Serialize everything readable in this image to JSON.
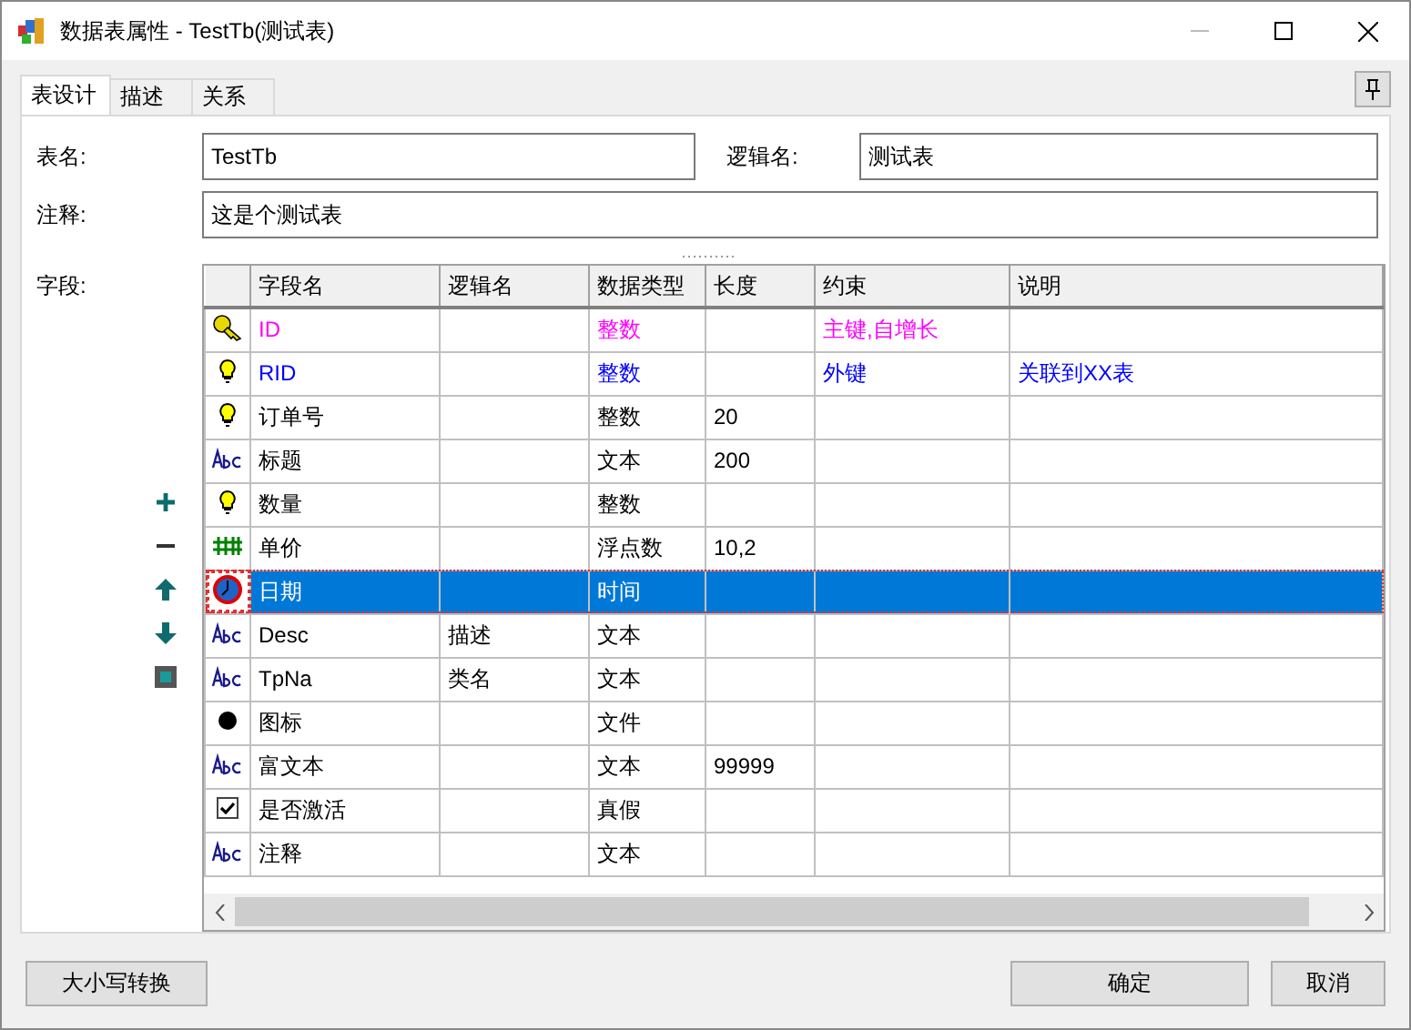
{
  "window": {
    "title": "数据表属性 - TestTb(测试表)"
  },
  "tabs": [
    {
      "label": "表设计",
      "selected": true
    },
    {
      "label": "描述",
      "selected": false
    },
    {
      "label": "关系",
      "selected": false
    }
  ],
  "form": {
    "table_name_label": "表名:",
    "table_name": "TestTb",
    "logical_name_label": "逻辑名:",
    "logical_name": "测试表",
    "comment_label": "注释:",
    "comment": "这是个测试表",
    "fields_label": "字段:"
  },
  "side_tools": [
    {
      "kind": "add"
    },
    {
      "kind": "remove"
    },
    {
      "kind": "up"
    },
    {
      "kind": "down"
    },
    {
      "kind": "square"
    }
  ],
  "table": {
    "columns": [
      "字段名",
      "逻辑名",
      "数据类型",
      "长度",
      "约束",
      "说明"
    ],
    "rows": [
      {
        "kind": "key",
        "color": "#ff00ff",
        "selected": false,
        "name": "ID",
        "type": "整数",
        "constraint": "主键,自增长"
      },
      {
        "kind": "bulb",
        "color": "#0000ff",
        "selected": false,
        "name": "RID",
        "type": "整数",
        "constraint": "外键",
        "note": "关联到XX表"
      },
      {
        "kind": "bulb",
        "color": "#000000",
        "selected": false,
        "name": "订单号",
        "type": "整数",
        "length": "20"
      },
      {
        "kind": "text",
        "color": "#000000",
        "selected": false,
        "name": "标题",
        "type": "文本",
        "length": "200"
      },
      {
        "kind": "bulb",
        "color": "#000000",
        "selected": false,
        "name": "数量",
        "type": "整数"
      },
      {
        "kind": "float",
        "color": "#000000",
        "selected": false,
        "name": "单价",
        "type": "浮点数",
        "length": "10,2"
      },
      {
        "kind": "clock",
        "selected": true,
        "name": "日期",
        "type": "时间"
      },
      {
        "kind": "text",
        "color": "#000000",
        "selected": false,
        "name": "Desc",
        "logical": "描述",
        "type": "文本"
      },
      {
        "kind": "text",
        "color": "#000000",
        "selected": false,
        "name": "TpNa",
        "logical": "类名",
        "type": "文本"
      },
      {
        "kind": "file",
        "color": "#000000",
        "selected": false,
        "name": "图标",
        "type": "文件"
      },
      {
        "kind": "text",
        "color": "#000000",
        "selected": false,
        "name": "富文本",
        "type": "文本",
        "length": "99999"
      },
      {
        "kind": "bool",
        "color": "#000000",
        "selected": false,
        "name": "是否激活",
        "type": "真假"
      },
      {
        "kind": "text",
        "color": "#000000",
        "selected": false,
        "name": "注释",
        "type": "文本"
      }
    ]
  },
  "buttons": {
    "case_convert": "大小写转换",
    "ok": "确定",
    "cancel": "取消"
  }
}
